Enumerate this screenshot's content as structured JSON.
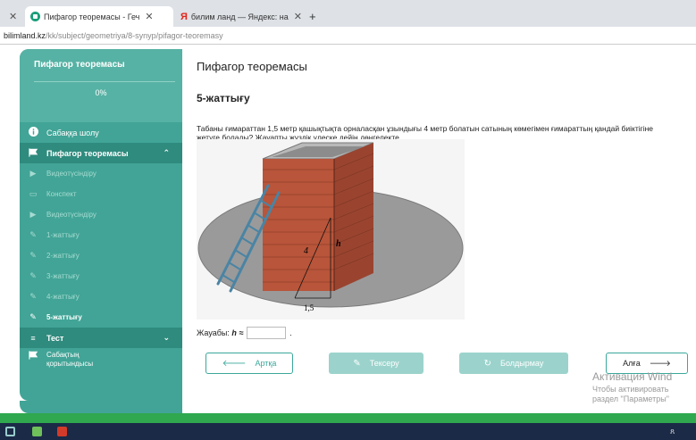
{
  "browser": {
    "tabs": [
      {
        "label": "Пифагор теоремасы - Геч",
        "active": true
      },
      {
        "label": "билим ланд — Яндекс: на",
        "active": false
      }
    ],
    "new_tab": "+",
    "close": "✕",
    "url_domain": "bilimland.kz",
    "url_path": "/kk/subject/geometriya/8-synyp/pifagor-teoremasy"
  },
  "sidebar": {
    "title": "Пифагор теоремасы",
    "progress": "0%",
    "items": [
      {
        "label": "Сабаққа шолу",
        "icon": "info-icon"
      },
      {
        "label": "Пифагор теоремасы",
        "icon": "flag-icon"
      },
      {
        "label": "Видеотүсіндіру",
        "icon": "play-icon"
      },
      {
        "label": "Конспект",
        "icon": "book-icon"
      },
      {
        "label": "Видеотүсіндіру",
        "icon": "play-icon"
      },
      {
        "label": "1-жаттығу",
        "icon": "edit-icon"
      },
      {
        "label": "2-жаттығу",
        "icon": "edit-icon"
      },
      {
        "label": "3-жаттығу",
        "icon": "edit-icon"
      },
      {
        "label": "4-жаттығу",
        "icon": "edit-icon"
      },
      {
        "label": "5-жаттығу",
        "icon": "edit-icon"
      },
      {
        "label": "Тест",
        "icon": "list-icon"
      },
      {
        "label": "Сабақтың қорытындысы",
        "icon": "flag-icon"
      }
    ]
  },
  "main": {
    "title": "Пифагор теоремасы",
    "exercise": "5-жаттығу",
    "problem": "Табаны ғимараттан 1,5 метр қашықтықта орналасқан ұзындығы 4 метр болатын сатының көмегімен ғимараттың қандай биіктігіне жетуге болады? Жауапты жүздік үлеске дейін дөңгелекте.",
    "figure_labels": {
      "ladder": "4",
      "height": "h",
      "base": "1,5"
    },
    "answer_label": "Жауабы:",
    "answer_var": "h ≈",
    "answer_end": ".",
    "answer_value": ""
  },
  "buttons": {
    "back": "Артқа",
    "check": "Тексеру",
    "give_up": "Болдырмау",
    "next": "Алға"
  },
  "watermark": {
    "line1": "Активация Wind",
    "line2": "Чтобы активировать",
    "line3": "раздел \"Параметры\""
  },
  "colors": {
    "accent": "#41a496",
    "accent_dark": "#2f8b7e",
    "taskbar": "#1b2a47",
    "status": "#2fa84f"
  }
}
